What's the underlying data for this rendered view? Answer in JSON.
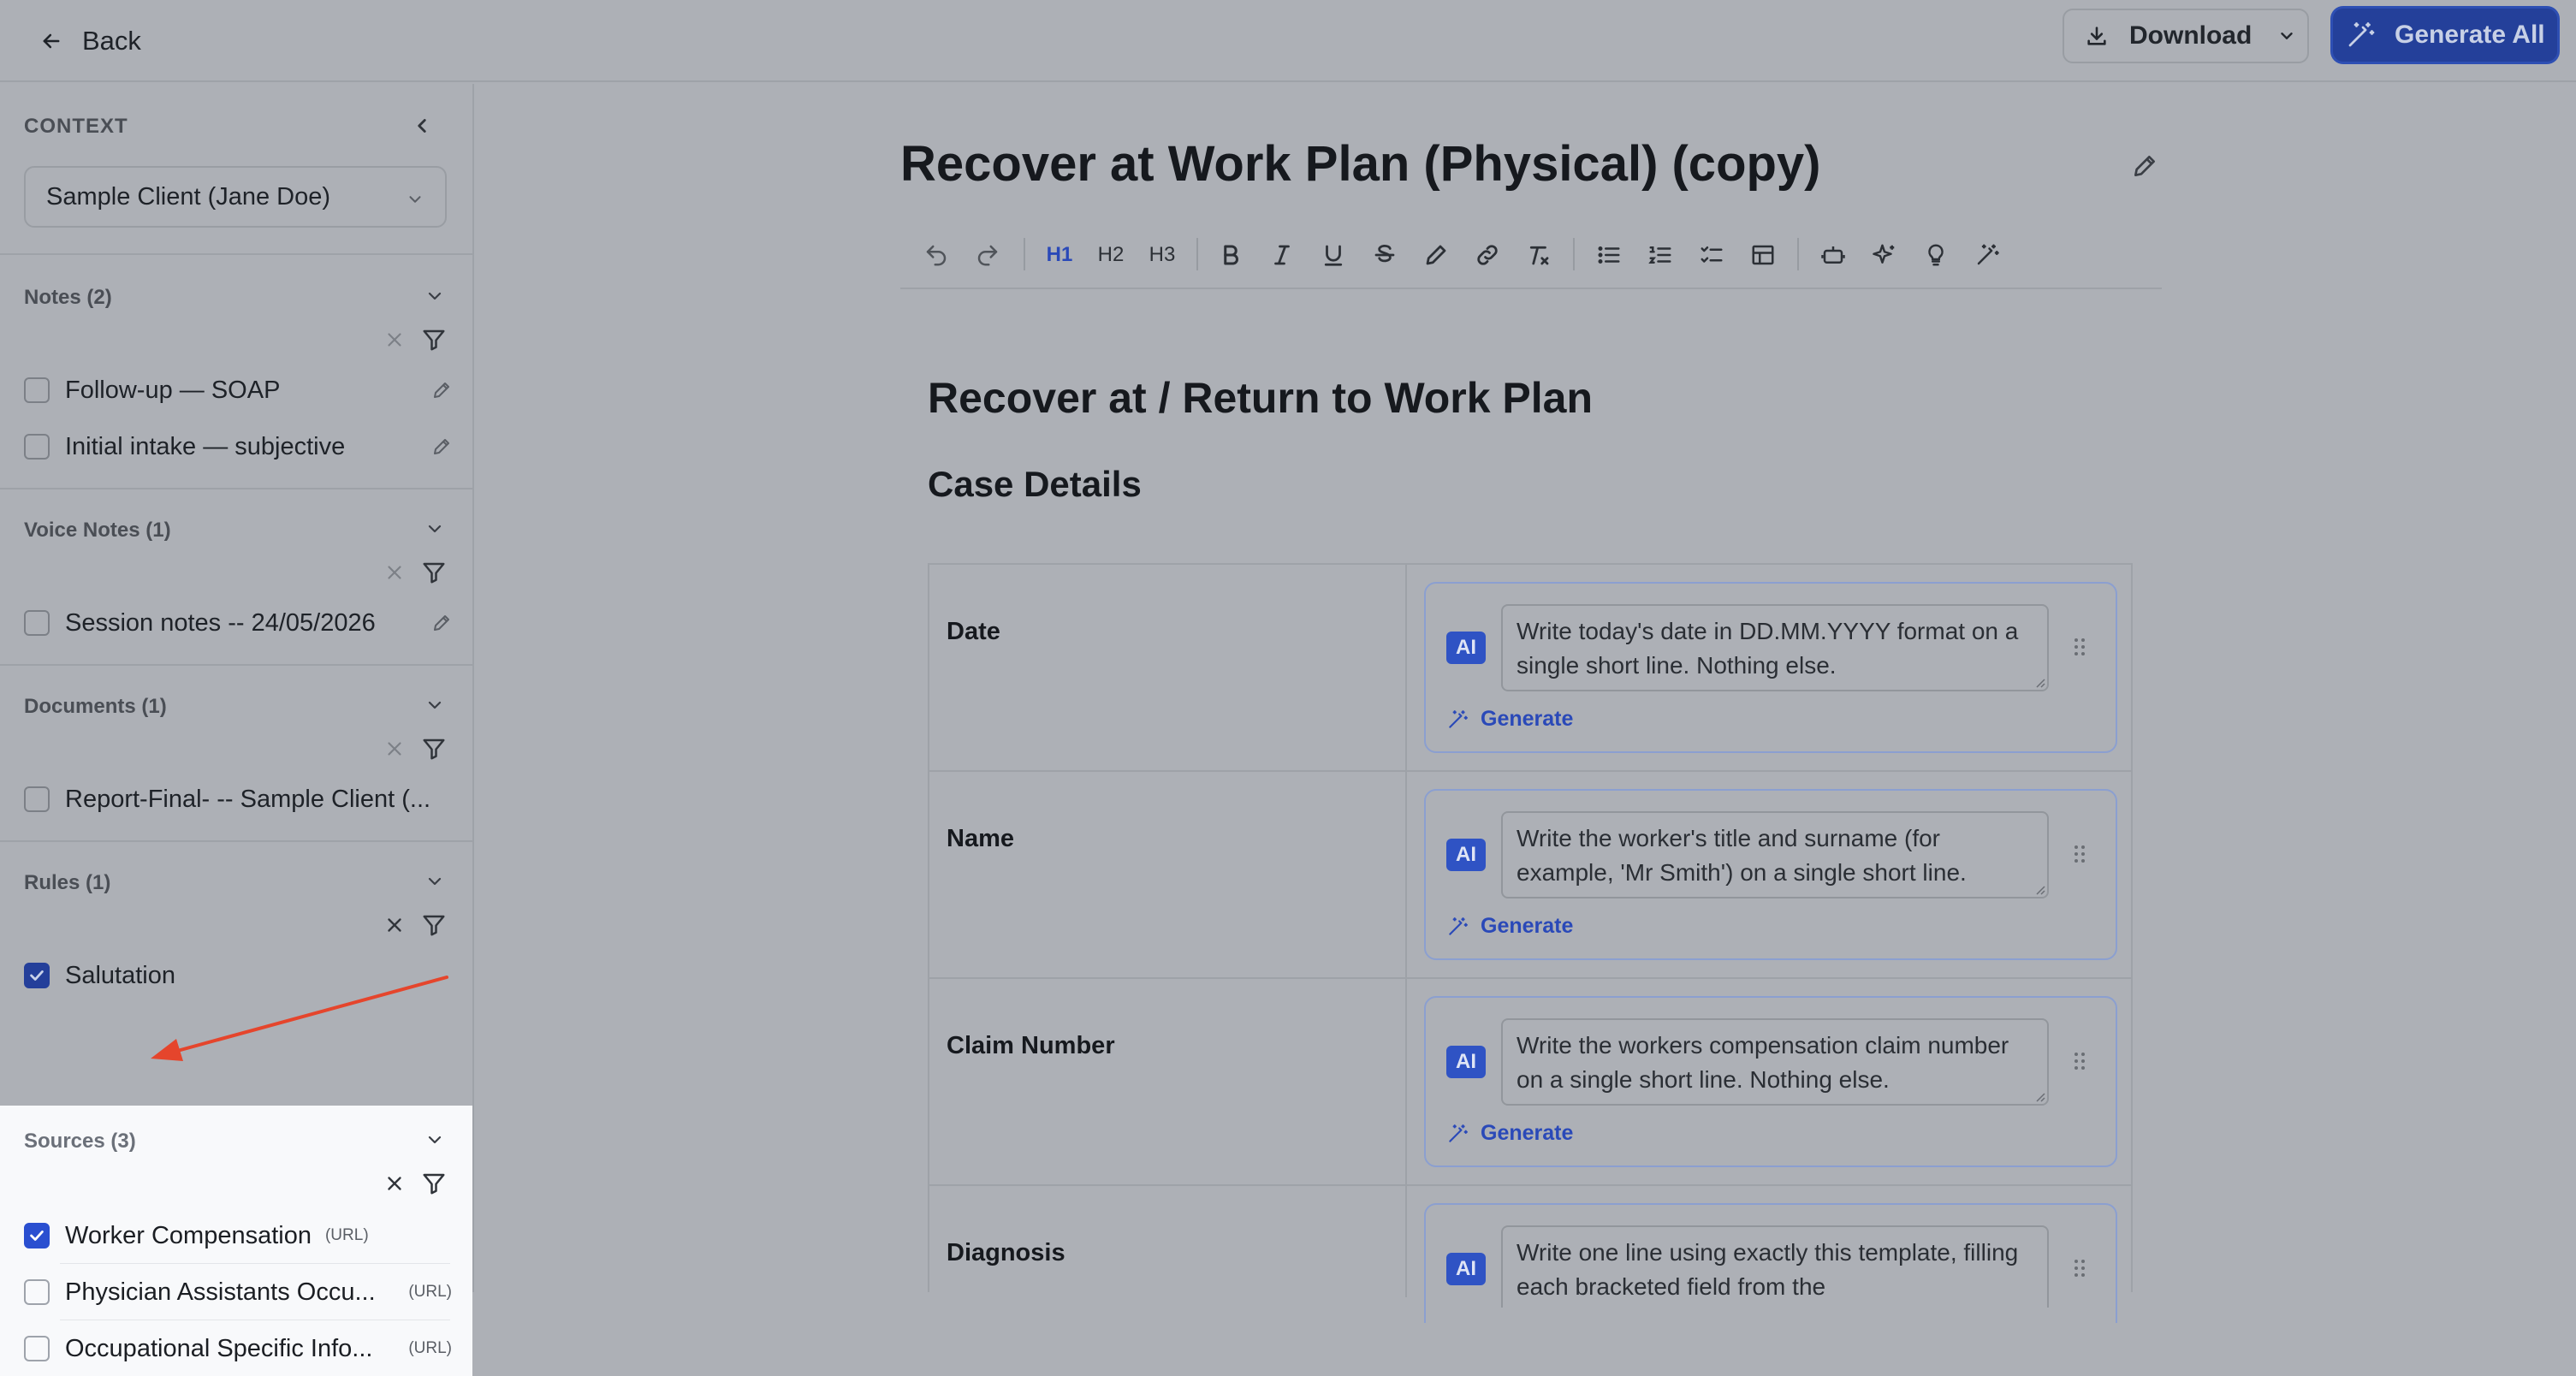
{
  "topbar": {
    "back_label": "Back",
    "download_label": "Download",
    "generate_all_label": "Generate All"
  },
  "sidebar": {
    "context_label": "CONTEXT",
    "context_selected": "Sample Client (Jane Doe)",
    "sections": {
      "notes": {
        "title": "Notes (2)",
        "items": [
          {
            "label": "Follow-up — SOAP",
            "checked": false
          },
          {
            "label": "Initial intake — subjective",
            "checked": false
          }
        ]
      },
      "voice_notes": {
        "title": "Voice Notes (1)",
        "items": [
          {
            "label": "Session notes -- 24/05/2026",
            "checked": false
          }
        ]
      },
      "documents": {
        "title": "Documents (1)",
        "items": [
          {
            "label": "Report-Final- -- Sample Client (...",
            "checked": false
          }
        ]
      },
      "rules": {
        "title": "Rules (1)",
        "items": [
          {
            "label": "Salutation",
            "checked": true
          }
        ]
      },
      "sources": {
        "title": "Sources (3)",
        "items": [
          {
            "label": "Worker Compensation",
            "tag": "(URL)",
            "checked": true
          },
          {
            "label": "Physician Assistants Occu...",
            "tag": "(URL)",
            "checked": false
          },
          {
            "label": "Occupational Specific Info...",
            "tag": "(URL)",
            "checked": false
          }
        ]
      }
    }
  },
  "editor": {
    "doc_title": "Recover at Work Plan (Physical) (copy)",
    "toolbar": {
      "h1": "H1",
      "h2": "H2",
      "h3": "H3"
    },
    "heading1": "Recover at / Return to Work Plan",
    "heading2": "Case Details",
    "ai_tag": "AI",
    "generate_label": "Generate",
    "rows": [
      {
        "label": "Date",
        "prompt": "Write today's date in DD.MM.YYYY format on a single short line. Nothing else."
      },
      {
        "label": "Name",
        "prompt": "Write the worker's title and surname (for example, 'Mr Smith') on a single short line."
      },
      {
        "label": "Claim Number",
        "prompt": "Write the workers compensation claim number on a single short line. Nothing else."
      },
      {
        "label": "Diagnosis",
        "prompt": "Write one line using exactly this template, filling each bracketed field from the"
      }
    ]
  },
  "colors": {
    "overlay_background": "#adb0b6",
    "primary_button": "#24409a",
    "highlight_panel": "#f8f9fb",
    "annotation_arrow": "#e5452c",
    "checkbox_checked": "#2a4fd0"
  }
}
